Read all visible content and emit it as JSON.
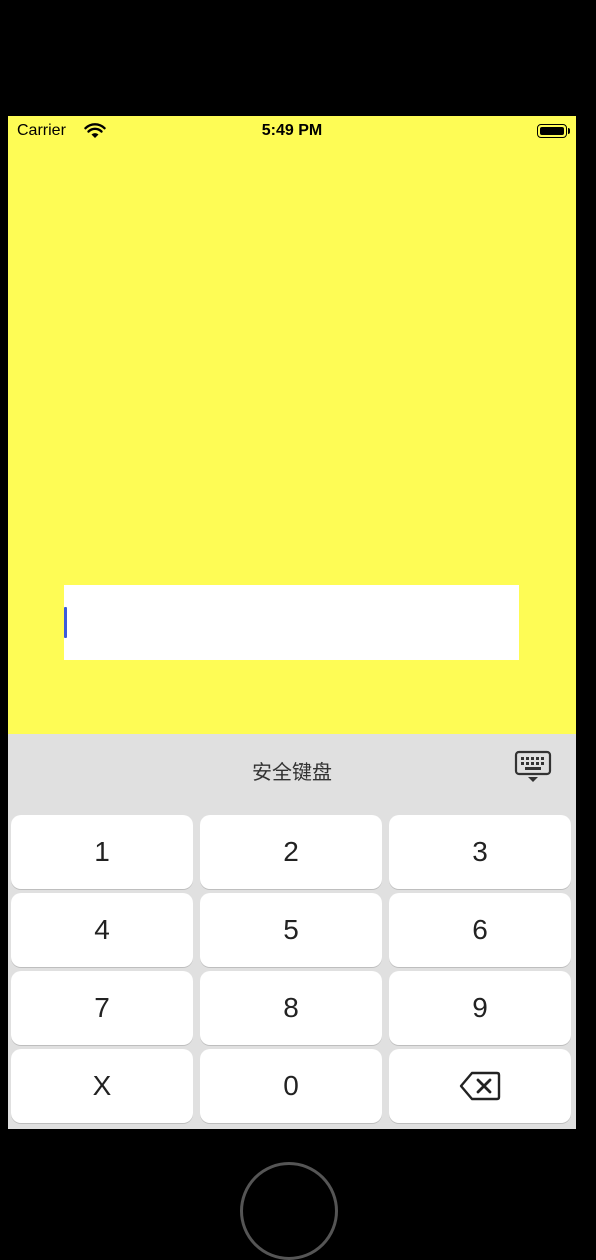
{
  "status_bar": {
    "carrier": "Carrier",
    "time": "5:49 PM"
  },
  "screen": {
    "background_color": "#fefc55",
    "text_input": {
      "value": "",
      "placeholder": ""
    }
  },
  "keyboard": {
    "title": "安全键盘",
    "keys": [
      [
        "1",
        "2",
        "3"
      ],
      [
        "4",
        "5",
        "6"
      ],
      [
        "7",
        "8",
        "9"
      ],
      [
        "X",
        "0",
        "backspace-icon"
      ]
    ],
    "dismiss_icon": "keyboard-dismiss-icon"
  }
}
